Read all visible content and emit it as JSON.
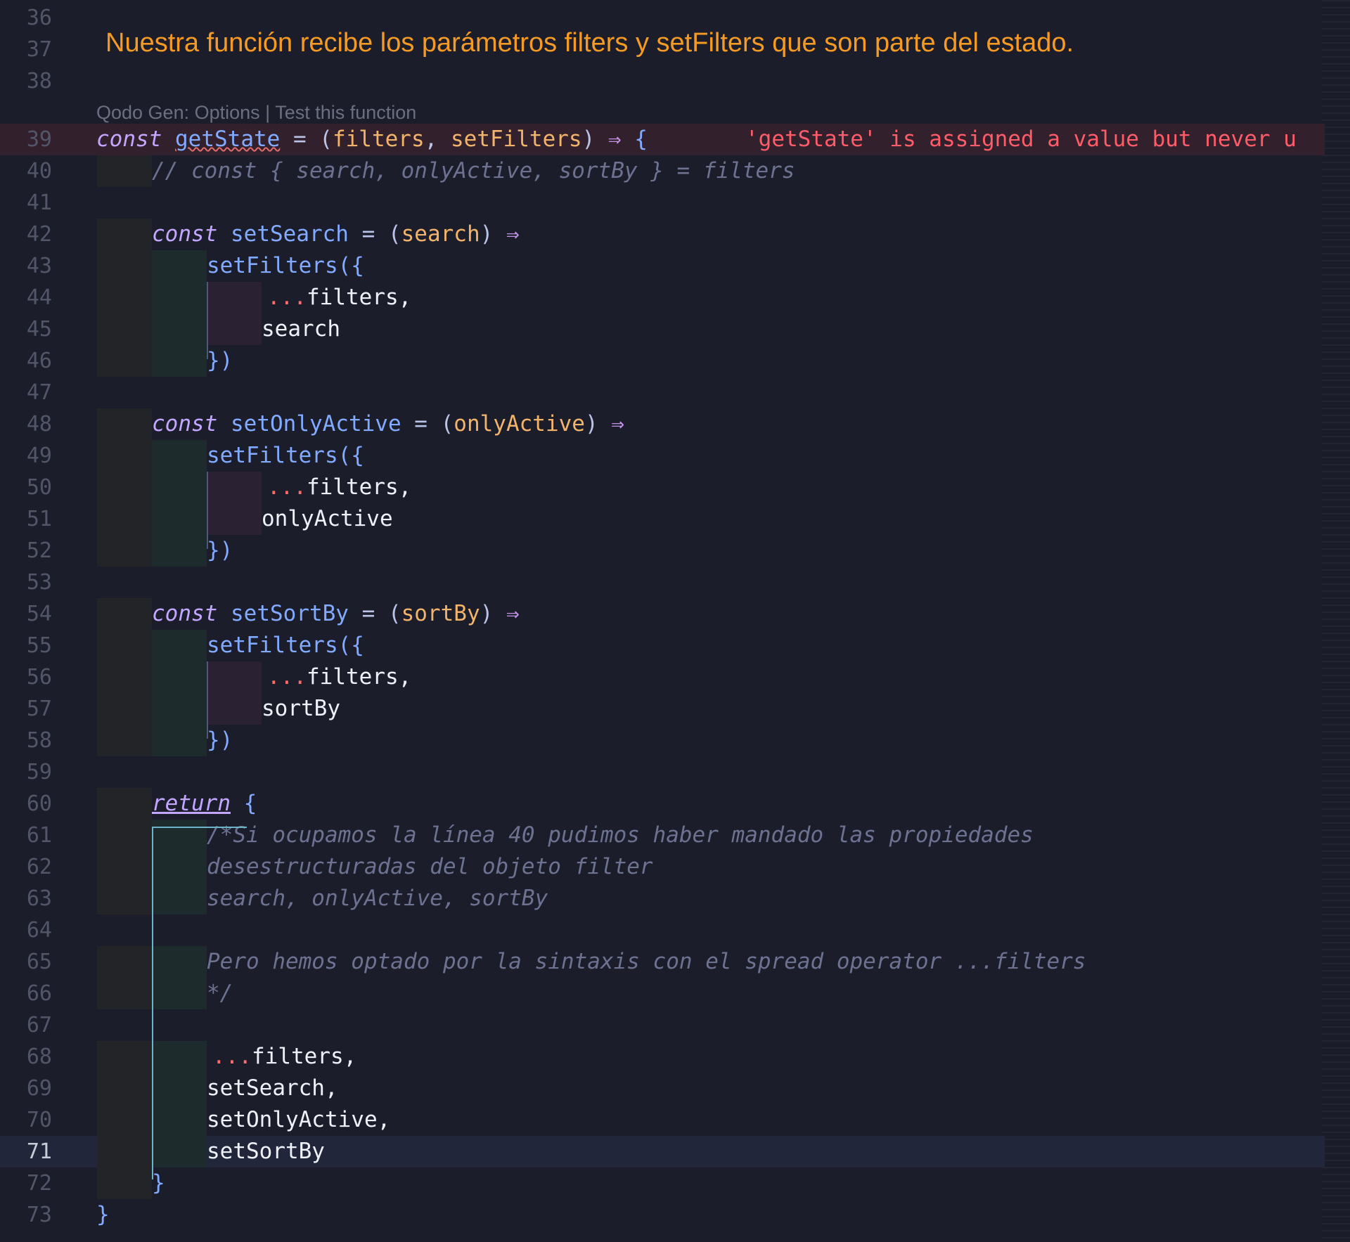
{
  "annotation": "Nuestra función recibe los parámetros filters y setFilters que son parte del estado.",
  "codelens": {
    "prefix": "Qodo Gen: ",
    "options": "Options",
    "separator": " | ",
    "test": "Test this function"
  },
  "error_message": "'getState' is assigned a value but never u",
  "colors": {
    "background": "#1b1d2b",
    "annotation": "#f59a23",
    "keyword": "#c3a6ff",
    "function": "#82aaff",
    "parameter": "#f2b36b",
    "spread": "#ff6b6b",
    "comment": "#6c7290",
    "error": "#ff5c6a",
    "bracket_guide": "#6cb4c9"
  },
  "lines": [
    {
      "n": "36"
    },
    {
      "n": "37"
    },
    {
      "n": "38"
    },
    {
      "n": "39",
      "t": [
        "const",
        " ",
        "getState",
        " = (",
        "filters",
        ", ",
        "setFilters",
        ") ",
        "⇒",
        " {"
      ]
    },
    {
      "n": "40",
      "text": "// const { search, onlyActive, sortBy } = filters"
    },
    {
      "n": "41"
    },
    {
      "n": "42",
      "t": [
        "const",
        " ",
        "setSearch",
        " = (",
        "search",
        ") ",
        "⇒"
      ]
    },
    {
      "n": "43",
      "t": [
        "setFilters",
        "({"
      ]
    },
    {
      "n": "44",
      "t": [
        "...",
        "filters,"
      ]
    },
    {
      "n": "45",
      "text": "search"
    },
    {
      "n": "46",
      "text": "})"
    },
    {
      "n": "47"
    },
    {
      "n": "48",
      "t": [
        "const",
        " ",
        "setOnlyActive",
        " = (",
        "onlyActive",
        ") ",
        "⇒"
      ]
    },
    {
      "n": "49",
      "t": [
        "setFilters",
        "({"
      ]
    },
    {
      "n": "50",
      "t": [
        "...",
        "filters,"
      ]
    },
    {
      "n": "51",
      "text": "onlyActive"
    },
    {
      "n": "52",
      "text": "})"
    },
    {
      "n": "53"
    },
    {
      "n": "54",
      "t": [
        "const",
        " ",
        "setSortBy",
        " = (",
        "sortBy",
        ") ",
        "⇒"
      ]
    },
    {
      "n": "55",
      "t": [
        "setFilters",
        "({"
      ]
    },
    {
      "n": "56",
      "t": [
        "...",
        "filters,"
      ]
    },
    {
      "n": "57",
      "text": "sortBy"
    },
    {
      "n": "58",
      "text": "})"
    },
    {
      "n": "59"
    },
    {
      "n": "60",
      "t": [
        "return",
        " ",
        "{"
      ]
    },
    {
      "n": "61",
      "text": "/*Si ocupamos la línea 40 pudimos haber mandado las propiedades"
    },
    {
      "n": "62",
      "text": "desestructuradas del objeto filter"
    },
    {
      "n": "63",
      "text": "search, onlyActive, sortBy"
    },
    {
      "n": "64"
    },
    {
      "n": "65",
      "text": "Pero hemos optado por la sintaxis con el spread operator ...filters"
    },
    {
      "n": "66",
      "text": "*/"
    },
    {
      "n": "67"
    },
    {
      "n": "68",
      "t": [
        "...",
        "filters,"
      ]
    },
    {
      "n": "69",
      "text": "setSearch,"
    },
    {
      "n": "70",
      "text": "setOnlyActive,"
    },
    {
      "n": "71",
      "text": "setSortBy"
    },
    {
      "n": "72",
      "text": "}"
    },
    {
      "n": "73",
      "text": "}"
    }
  ]
}
